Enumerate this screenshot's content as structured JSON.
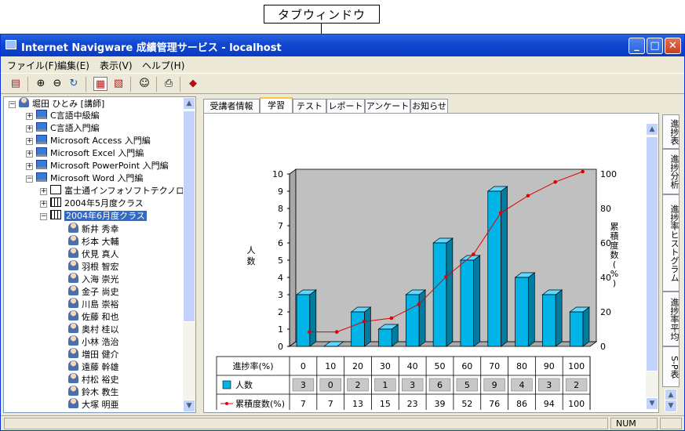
{
  "callout": {
    "label": "タブウィンドウ"
  },
  "window": {
    "title": "Internet Navigware 成績管理サービス - localhost",
    "minimize": "_",
    "maximize": "□",
    "close": "✕"
  },
  "menu": [
    "ファイル(F)",
    "編集(E)",
    "表示(V)",
    "ヘルプ(H)"
  ],
  "toolbar_icons": [
    "tree-view-icon",
    "zoom-in-icon",
    "zoom-out-icon",
    "refresh-icon",
    "layout-a-icon",
    "layout-b-icon",
    "user-card-icon",
    "print-icon",
    "book-icon"
  ],
  "tree": {
    "root": "堀田 ひとみ [講師]",
    "courses": [
      "C言語中級編",
      "C言語入門編",
      "Microsoft Access 入門編",
      "Microsoft Excel 入門編",
      "Microsoft PowerPoint 入門編",
      "Microsoft Word 入門編"
    ],
    "groups": [
      "富士通インフォソフトテクノロジ",
      "2004年5月度クラス",
      "2004年6月度クラス"
    ],
    "students": [
      "新井 秀幸",
      "杉本 大輔",
      "伏見 真人",
      "羽根 智宏",
      "入海 崇光",
      "金子 尚史",
      "川島 崇裕",
      "佐藤 和也",
      "奥村 桂以",
      "小林 浩治",
      "増田 健介",
      "遠藤 幹雄",
      "村松 裕史",
      "鈴木 教生",
      "大塚 明亜"
    ]
  },
  "tabs": [
    "受講者情報",
    "学習",
    "テスト",
    "レポート",
    "アンケート",
    "お知らせ"
  ],
  "active_tab": "学習",
  "side_tabs": [
    "進捗表",
    "進捗分析",
    "進捗率ヒストグラム",
    "進捗率平均",
    "S-P表"
  ],
  "status": {
    "num": "NUM"
  },
  "chart_data": {
    "type": "bar",
    "categories": [
      "0",
      "10",
      "20",
      "30",
      "40",
      "50",
      "60",
      "70",
      "80",
      "90",
      "100"
    ],
    "series": [
      {
        "name": "人数",
        "values": [
          3,
          0,
          2,
          1,
          3,
          6,
          5,
          9,
          4,
          3,
          2
        ],
        "color": "#00b4e8",
        "axis": "left"
      },
      {
        "name": "累積度数(%)",
        "values": [
          7,
          7,
          13,
          15,
          23,
          39,
          52,
          76,
          86,
          94,
          100
        ],
        "color": "#e00000",
        "axis": "right",
        "type": "line"
      }
    ],
    "ylabel_left": "人数",
    "ylabel_right": "累積度数(%)",
    "ylim_left": [
      0,
      10
    ],
    "ylim_right": [
      0,
      100
    ],
    "yticks_left": [
      "0",
      "1",
      "2",
      "3",
      "4",
      "5",
      "6",
      "7",
      "8",
      "9",
      "10"
    ],
    "yticks_right": [
      "0",
      "20",
      "40",
      "60",
      "80",
      "100"
    ],
    "table_header": "進捗率(%)",
    "table_rows": [
      "人数",
      "累積度数(%)"
    ],
    "plot_background": "#c0c0c0"
  }
}
